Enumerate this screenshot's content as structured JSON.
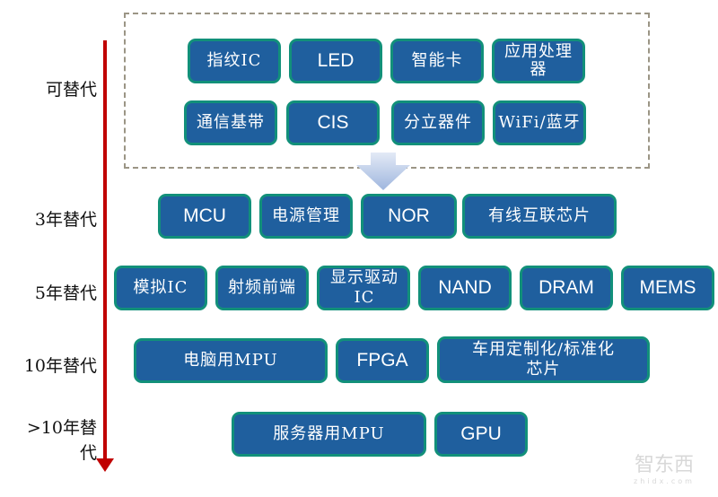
{
  "colors": {
    "chip_fill": "#1f5f9e",
    "chip_border": "#12907a",
    "timeline": "#c00000",
    "dashed_border": "#9b9585",
    "arrow": "#a9bde0"
  },
  "rows": [
    {
      "label": "可替代",
      "items": [
        "指纹IC",
        "LED",
        "智能卡",
        "应用处理\n器",
        "通信基带",
        "CIS",
        "分立器件",
        "WiFi/蓝牙"
      ]
    },
    {
      "label": "3年替代",
      "items": [
        "MCU",
        "电源管理",
        "NOR",
        "有线互联芯片"
      ]
    },
    {
      "label": "5年替代",
      "items": [
        "模拟IC",
        "射频前端",
        "显示驱动IC",
        "NAND",
        "DRAM",
        "MEMS"
      ]
    },
    {
      "label": "10年替代",
      "items": [
        "电脑用MPU",
        "FPGA",
        "车用定制化/标准化\n芯片"
      ]
    },
    {
      "label": ">10年替\n代",
      "items": [
        "服务器用MPU",
        "GPU"
      ]
    }
  ],
  "icons": {
    "timeline_arrow": "arrow-down-red",
    "flow_arrow": "arrow-down-gradient"
  },
  "watermark": {
    "text": "智东西",
    "sub": "zhidx.com"
  }
}
